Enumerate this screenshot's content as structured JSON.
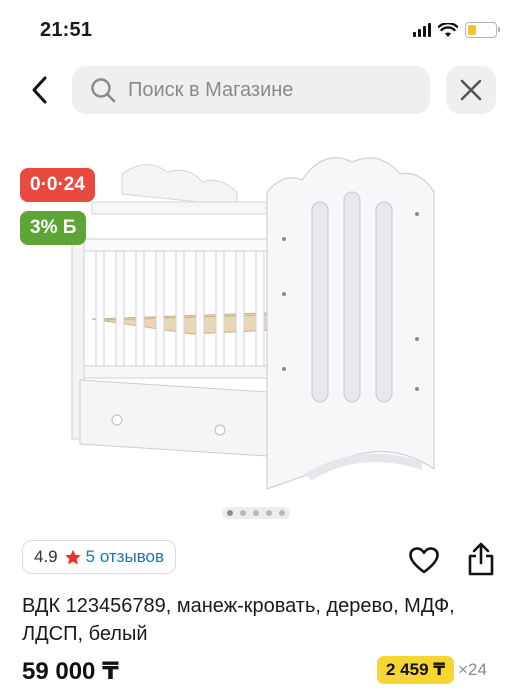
{
  "status_bar": {
    "time": "21:51"
  },
  "nav": {
    "search_placeholder": "Поиск в Магазине"
  },
  "gallery": {
    "badges": [
      {
        "label": "0·0·24",
        "color": "#e84a3f"
      },
      {
        "label": "3% Б",
        "color": "#5ea537"
      }
    ],
    "slide_count": 5,
    "active_slide": 1
  },
  "rating": {
    "score": "4.9",
    "reviews": "5 отзывов",
    "star_color": "#e8312a"
  },
  "product": {
    "title": "ВДК 123456789, манеж-кровать, дерево, МДФ, ЛДСП, белый",
    "price": "59 000 ₸",
    "installment_amount": "2 459 ₸",
    "installment_months": "×24"
  },
  "colors": {
    "accent_link": "#1a73c7",
    "installment_bg": "#f8d631"
  }
}
